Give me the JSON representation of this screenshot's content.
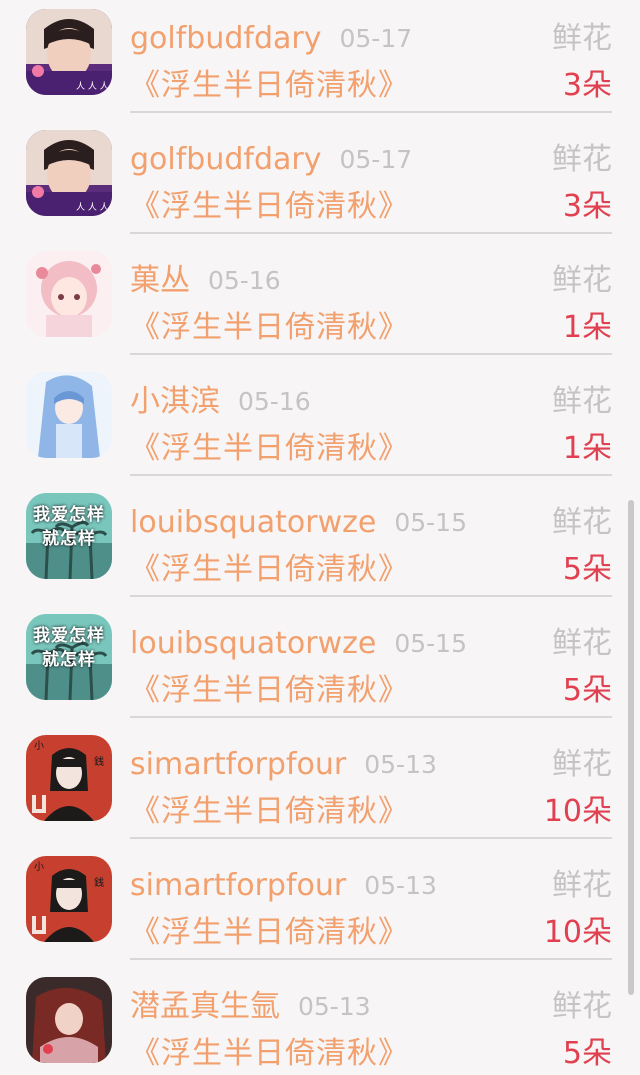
{
  "list": {
    "items": [
      {
        "name": "golfbudfdary",
        "date": "05-17",
        "album": "《浮生半日倚清秋》",
        "gift": "鲜花",
        "count": "3朵",
        "avatar": "boy-selfie"
      },
      {
        "name": "golfbudfdary",
        "date": "05-17",
        "album": "《浮生半日倚清秋》",
        "gift": "鲜花",
        "count": "3朵",
        "avatar": "boy-selfie"
      },
      {
        "name": "菓丛",
        "date": "05-16",
        "album": "《浮生半日倚清秋》",
        "gift": "鲜花",
        "count": "1朵",
        "avatar": "pink-anime-girl"
      },
      {
        "name": "小淇滨",
        "date": "05-16",
        "album": "《浮生半日倚清秋》",
        "gift": "鲜花",
        "count": "1朵",
        "avatar": "blue-anime-girl"
      },
      {
        "name": "louibsquatorwze",
        "date": "05-15",
        "album": "《浮生半日倚清秋》",
        "gift": "鲜花",
        "count": "5朵",
        "avatar": "palm-text",
        "avatar_text": [
          "我爱怎样",
          "就怎样"
        ]
      },
      {
        "name": "louibsquatorwze",
        "date": "05-15",
        "album": "《浮生半日倚清秋》",
        "gift": "鲜花",
        "count": "5朵",
        "avatar": "palm-text",
        "avatar_text": [
          "我爱怎样",
          "就怎样"
        ]
      },
      {
        "name": "simartforpfour",
        "date": "05-13",
        "album": "《浮生半日倚清秋》",
        "gift": "鲜花",
        "count": "10朵",
        "avatar": "red-girl"
      },
      {
        "name": "simartforpfour",
        "date": "05-13",
        "album": "《浮生半日倚清秋》",
        "gift": "鲜花",
        "count": "10朵",
        "avatar": "red-girl"
      },
      {
        "name": "潜孟真生氩",
        "date": "05-13",
        "album": "《浮生半日倚清秋》",
        "gift": "鲜花",
        "count": "5朵",
        "avatar": "red-hair-girl"
      }
    ]
  }
}
